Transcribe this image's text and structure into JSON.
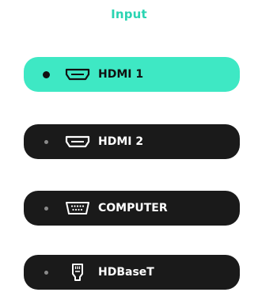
{
  "panel": {
    "title": "Input",
    "accent_color": "#3ee8c4",
    "title_color": "#2ad4b2",
    "button_color": "#1a1a1a"
  },
  "inputs": [
    {
      "label": "HDMI 1",
      "icon": "hdmi-icon",
      "selected": true
    },
    {
      "label": "HDMI 2",
      "icon": "hdmi-icon",
      "selected": false
    },
    {
      "label": "COMPUTER",
      "icon": "vga-port-icon",
      "selected": false
    },
    {
      "label": "HDBaseT",
      "icon": "ethernet-port-icon",
      "selected": false
    }
  ]
}
